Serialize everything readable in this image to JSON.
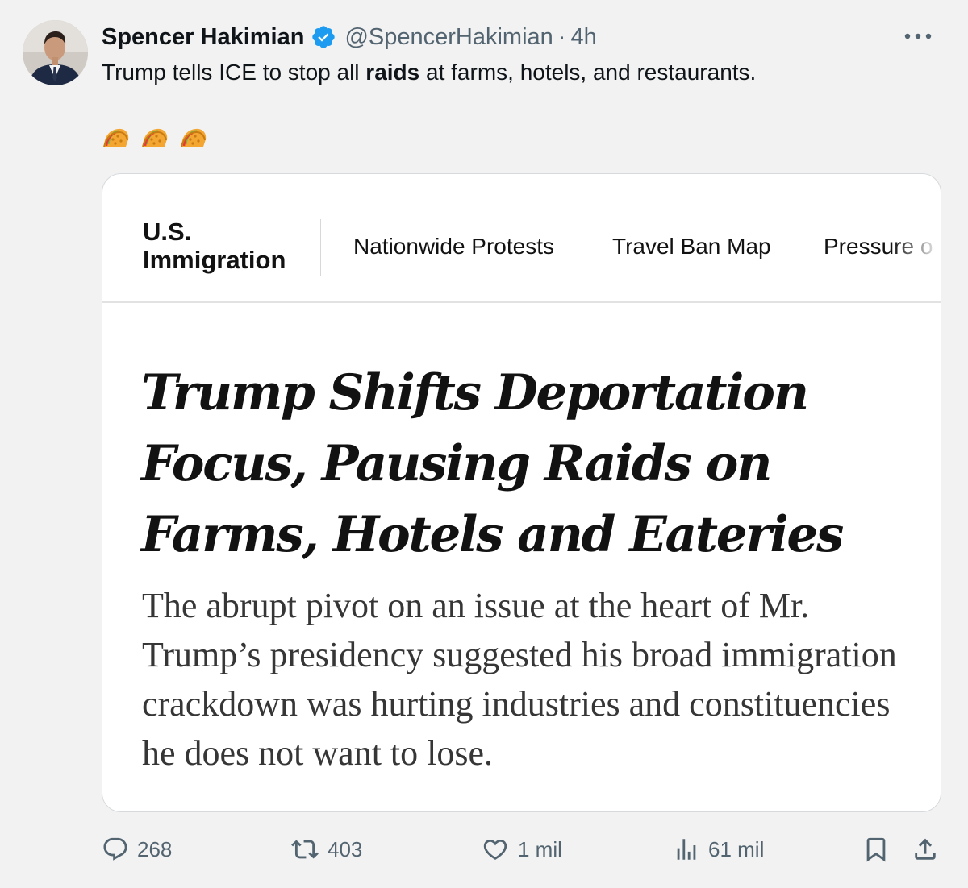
{
  "author": {
    "name": "Spencer Hakimian",
    "handle": "@SpencerHakimian",
    "separator": "·",
    "time": "4h"
  },
  "tweet": {
    "text_before": "Trump tells ICE to stop all ",
    "text_bold": "raids",
    "text_after": " at farms, hotels, and restaurants.",
    "emojis": [
      "taco-emoji",
      "taco-emoji",
      "taco-emoji"
    ]
  },
  "card": {
    "section_line1": "U.S.",
    "section_line2": "Immigration",
    "nav": [
      "Nationwide Protests",
      "Travel Ban Map",
      "Pressure o"
    ],
    "headline": "Trump Shifts Deportation Focus, Pausing Raids on Farms, Hotels and Eateries",
    "summary": "The abrupt pivot on an issue at the heart of Mr. Trump’s presidency suggested his broad immigration crackdown was hurting industries and constituencies he does not want to lose."
  },
  "actions": {
    "replies": "268",
    "reposts": "403",
    "likes": "1 mil",
    "views": "61 mil"
  },
  "icons": {
    "more": "more-icon",
    "verified": "verified-badge-icon",
    "reply": "reply-icon",
    "repost": "repost-icon",
    "like": "heart-icon",
    "views": "views-icon",
    "bookmark": "bookmark-icon",
    "share": "share-icon"
  },
  "colors": {
    "verified_blue": "#1d9bf0",
    "muted_text": "#536471",
    "background": "#f2f2f2"
  }
}
